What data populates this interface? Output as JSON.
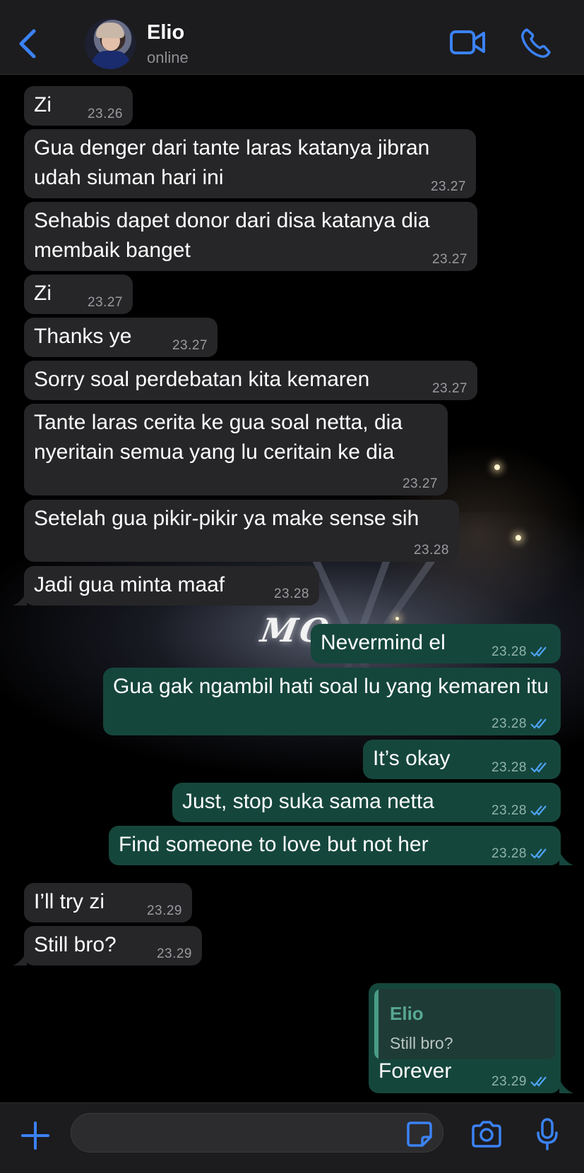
{
  "header": {
    "back_icon": "chevron-left-icon",
    "contact_name": "Elio",
    "contact_status": "online",
    "video_icon": "video-camera-icon",
    "call_icon": "phone-icon",
    "accent_color": "#3b82f6"
  },
  "background": {
    "sign_text": "MO",
    "sign_text_hidden": "MOMENTS"
  },
  "messages": [
    {
      "direction": "in",
      "text": "Zi",
      "time": "23.26"
    },
    {
      "direction": "in",
      "text": "Gua denger dari tante laras katanya jibran udah siuman hari ini",
      "time": "23.27"
    },
    {
      "direction": "in",
      "text": "Sehabis dapet donor dari disa katanya dia membaik banget",
      "time": "23.27"
    },
    {
      "direction": "in",
      "text": "Zi",
      "time": "23.27"
    },
    {
      "direction": "in",
      "text": "Thanks ye",
      "time": "23.27"
    },
    {
      "direction": "in",
      "text": "Sorry soal perdebatan kita kemaren",
      "time": "23.27"
    },
    {
      "direction": "in",
      "text": "Tante laras cerita ke gua soal netta, dia nyeritain semua yang lu ceritain ke dia",
      "time": "23.27"
    },
    {
      "direction": "in",
      "text": "Setelah gua pikir-pikir ya make sense sih",
      "time": "23.28"
    },
    {
      "direction": "in",
      "text": "Jadi gua minta maaf",
      "time": "23.28"
    },
    {
      "direction": "out",
      "text": "Nevermind el",
      "time": "23.28",
      "status": "read"
    },
    {
      "direction": "out",
      "text": "Gua gak ngambil hati soal lu yang kemaren itu",
      "time": "23.28",
      "status": "read"
    },
    {
      "direction": "out",
      "text": "It’s okay",
      "time": "23.28",
      "status": "read"
    },
    {
      "direction": "out",
      "text": "Just, stop suka sama netta",
      "time": "23.28",
      "status": "read"
    },
    {
      "direction": "out",
      "text": "Find someone to love but not her",
      "time": "23.28",
      "status": "read"
    },
    {
      "direction": "in",
      "text": "I’ll try zi",
      "time": "23.29"
    },
    {
      "direction": "in",
      "text": "Still bro?",
      "time": "23.29"
    },
    {
      "direction": "out",
      "text": "Forever",
      "time": "23.29",
      "status": "read",
      "reply_to": {
        "name": "Elio",
        "text": "Still bro?"
      }
    }
  ],
  "input_bar": {
    "plus_icon": "plus-icon",
    "placeholder": "",
    "value": "",
    "sticker_icon": "sticker-icon",
    "camera_icon": "camera-icon",
    "mic_icon": "microphone-icon"
  }
}
